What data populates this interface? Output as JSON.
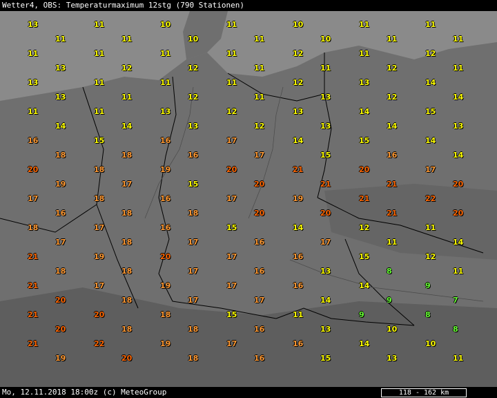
{
  "header": {
    "title": "Wetter4, OBS: Temperaturmaximum 12stg (790 Stationen)"
  },
  "footer": {
    "datetime": "Mo, 12.11.2018 18:00z (c) MeteoGroup",
    "scale": "118 - 162 km"
  },
  "colors": {
    "cold": "#ffff00",
    "mild": "#ff9933",
    "warm": "#ff6600",
    "cool": "#66ff33",
    "sea": "#8a8a8a",
    "land": "#6f6f6f"
  },
  "stations": [
    {
      "v": "13",
      "c": "cold"
    },
    {
      "v": "11",
      "c": "cold"
    },
    {
      "v": "10",
      "c": "cold"
    },
    {
      "v": "11",
      "c": "cold"
    },
    {
      "v": "10",
      "c": "cold"
    },
    {
      "v": "11",
      "c": "cold"
    },
    {
      "v": "11",
      "c": "cold"
    },
    {
      "v": "11",
      "c": "cold"
    },
    {
      "v": "11",
      "c": "cold"
    },
    {
      "v": "10",
      "c": "cold"
    },
    {
      "v": "11",
      "c": "cold"
    },
    {
      "v": "10",
      "c": "cold"
    },
    {
      "v": "11",
      "c": "cold"
    },
    {
      "v": "11",
      "c": "cold"
    },
    {
      "v": "11",
      "c": "cold"
    },
    {
      "v": "11",
      "c": "cold"
    },
    {
      "v": "11",
      "c": "cold"
    },
    {
      "v": "11",
      "c": "cold"
    },
    {
      "v": "12",
      "c": "cold"
    },
    {
      "v": "11",
      "c": "cold"
    },
    {
      "v": "12",
      "c": "cold"
    },
    {
      "v": "13",
      "c": "cold"
    },
    {
      "v": "12",
      "c": "cold"
    },
    {
      "v": "12",
      "c": "cold"
    },
    {
      "v": "11",
      "c": "cold"
    },
    {
      "v": "11",
      "c": "cold"
    },
    {
      "v": "12",
      "c": "cold"
    },
    {
      "v": "11",
      "c": "cold"
    },
    {
      "v": "13",
      "c": "cold"
    },
    {
      "v": "11",
      "c": "cold"
    },
    {
      "v": "11",
      "c": "cold"
    },
    {
      "v": "11",
      "c": "cold"
    },
    {
      "v": "12",
      "c": "cold"
    },
    {
      "v": "13",
      "c": "cold"
    },
    {
      "v": "14",
      "c": "cold"
    },
    {
      "v": "13",
      "c": "cold"
    },
    {
      "v": "11",
      "c": "cold"
    },
    {
      "v": "12",
      "c": "cold"
    },
    {
      "v": "11",
      "c": "cold"
    },
    {
      "v": "13",
      "c": "cold"
    },
    {
      "v": "12",
      "c": "cold"
    },
    {
      "v": "14",
      "c": "cold"
    },
    {
      "v": "11",
      "c": "cold"
    },
    {
      "v": "11",
      "c": "cold"
    },
    {
      "v": "13",
      "c": "cold"
    },
    {
      "v": "12",
      "c": "cold"
    },
    {
      "v": "13",
      "c": "cold"
    },
    {
      "v": "14",
      "c": "cold"
    },
    {
      "v": "15",
      "c": "cold"
    },
    {
      "v": "14",
      "c": "cold"
    },
    {
      "v": "14",
      "c": "cold"
    },
    {
      "v": "13",
      "c": "cold"
    },
    {
      "v": "12",
      "c": "cold"
    },
    {
      "v": "13",
      "c": "cold"
    },
    {
      "v": "14",
      "c": "cold"
    },
    {
      "v": "13",
      "c": "cold"
    },
    {
      "v": "16",
      "c": "mild"
    },
    {
      "v": "15",
      "c": "cold"
    },
    {
      "v": "16",
      "c": "mild"
    },
    {
      "v": "17",
      "c": "mild"
    },
    {
      "v": "14",
      "c": "cold"
    },
    {
      "v": "15",
      "c": "cold"
    },
    {
      "v": "14",
      "c": "cold"
    },
    {
      "v": "18",
      "c": "mild"
    },
    {
      "v": "18",
      "c": "mild"
    },
    {
      "v": "16",
      "c": "mild"
    },
    {
      "v": "17",
      "c": "mild"
    },
    {
      "v": "15",
      "c": "cold"
    },
    {
      "v": "16",
      "c": "mild"
    },
    {
      "v": "14",
      "c": "cold"
    },
    {
      "v": "20",
      "c": "warm"
    },
    {
      "v": "18",
      "c": "mild"
    },
    {
      "v": "19",
      "c": "mild"
    },
    {
      "v": "20",
      "c": "warm"
    },
    {
      "v": "21",
      "c": "warm"
    },
    {
      "v": "20",
      "c": "warm"
    },
    {
      "v": "17",
      "c": "mild"
    },
    {
      "v": "19",
      "c": "mild"
    },
    {
      "v": "17",
      "c": "mild"
    },
    {
      "v": "15",
      "c": "cold"
    },
    {
      "v": "20",
      "c": "warm"
    },
    {
      "v": "21",
      "c": "warm"
    },
    {
      "v": "21",
      "c": "warm"
    },
    {
      "v": "20",
      "c": "warm"
    },
    {
      "v": "17",
      "c": "mild"
    },
    {
      "v": "18",
      "c": "mild"
    },
    {
      "v": "16",
      "c": "mild"
    },
    {
      "v": "17",
      "c": "mild"
    },
    {
      "v": "19",
      "c": "mild"
    },
    {
      "v": "21",
      "c": "warm"
    },
    {
      "v": "22",
      "c": "warm"
    },
    {
      "v": "16",
      "c": "mild"
    },
    {
      "v": "18",
      "c": "mild"
    },
    {
      "v": "18",
      "c": "mild"
    },
    {
      "v": "20",
      "c": "warm"
    },
    {
      "v": "20",
      "c": "warm"
    },
    {
      "v": "21",
      "c": "warm"
    },
    {
      "v": "20",
      "c": "warm"
    },
    {
      "v": "18",
      "c": "mild"
    },
    {
      "v": "17",
      "c": "mild"
    },
    {
      "v": "16",
      "c": "mild"
    },
    {
      "v": "15",
      "c": "cold"
    },
    {
      "v": "14",
      "c": "cold"
    },
    {
      "v": "12",
      "c": "cold"
    },
    {
      "v": "11",
      "c": "cold"
    },
    {
      "v": "17",
      "c": "mild"
    },
    {
      "v": "18",
      "c": "mild"
    },
    {
      "v": "17",
      "c": "mild"
    },
    {
      "v": "16",
      "c": "mild"
    },
    {
      "v": "17",
      "c": "mild"
    },
    {
      "v": "11",
      "c": "cold"
    },
    {
      "v": "14",
      "c": "cold"
    },
    {
      "v": "21",
      "c": "warm"
    },
    {
      "v": "19",
      "c": "mild"
    },
    {
      "v": "20",
      "c": "warm"
    },
    {
      "v": "17",
      "c": "mild"
    },
    {
      "v": "16",
      "c": "mild"
    },
    {
      "v": "15",
      "c": "cold"
    },
    {
      "v": "12",
      "c": "cold"
    },
    {
      "v": "18",
      "c": "mild"
    },
    {
      "v": "18",
      "c": "mild"
    },
    {
      "v": "17",
      "c": "mild"
    },
    {
      "v": "16",
      "c": "mild"
    },
    {
      "v": "13",
      "c": "cold"
    },
    {
      "v": "8",
      "c": "cool"
    },
    {
      "v": "11",
      "c": "cold"
    },
    {
      "v": "21",
      "c": "warm"
    },
    {
      "v": "17",
      "c": "mild"
    },
    {
      "v": "19",
      "c": "mild"
    },
    {
      "v": "17",
      "c": "mild"
    },
    {
      "v": "16",
      "c": "mild"
    },
    {
      "v": "14",
      "c": "cold"
    },
    {
      "v": "9",
      "c": "cool"
    },
    {
      "v": "20",
      "c": "warm"
    },
    {
      "v": "18",
      "c": "mild"
    },
    {
      "v": "17",
      "c": "mild"
    },
    {
      "v": "17",
      "c": "mild"
    },
    {
      "v": "14",
      "c": "cold"
    },
    {
      "v": "9",
      "c": "cool"
    },
    {
      "v": "7",
      "c": "cool"
    },
    {
      "v": "21",
      "c": "warm"
    },
    {
      "v": "20",
      "c": "warm"
    },
    {
      "v": "18",
      "c": "mild"
    },
    {
      "v": "15",
      "c": "cold"
    },
    {
      "v": "11",
      "c": "cold"
    },
    {
      "v": "9",
      "c": "cool"
    },
    {
      "v": "8",
      "c": "cool"
    },
    {
      "v": "20",
      "c": "warm"
    },
    {
      "v": "18",
      "c": "mild"
    },
    {
      "v": "18",
      "c": "mild"
    },
    {
      "v": "16",
      "c": "mild"
    },
    {
      "v": "13",
      "c": "cold"
    },
    {
      "v": "10",
      "c": "cold"
    },
    {
      "v": "8",
      "c": "cool"
    },
    {
      "v": "21",
      "c": "warm"
    },
    {
      "v": "22",
      "c": "warm"
    },
    {
      "v": "19",
      "c": "mild"
    },
    {
      "v": "17",
      "c": "mild"
    },
    {
      "v": "16",
      "c": "mild"
    },
    {
      "v": "14",
      "c": "cold"
    },
    {
      "v": "10",
      "c": "cold"
    },
    {
      "v": "19",
      "c": "mild"
    },
    {
      "v": "20",
      "c": "warm"
    },
    {
      "v": "18",
      "c": "mild"
    },
    {
      "v": "16",
      "c": "mild"
    },
    {
      "v": "15",
      "c": "cold"
    },
    {
      "v": "13",
      "c": "cold"
    },
    {
      "v": "11",
      "c": "cold"
    }
  ]
}
